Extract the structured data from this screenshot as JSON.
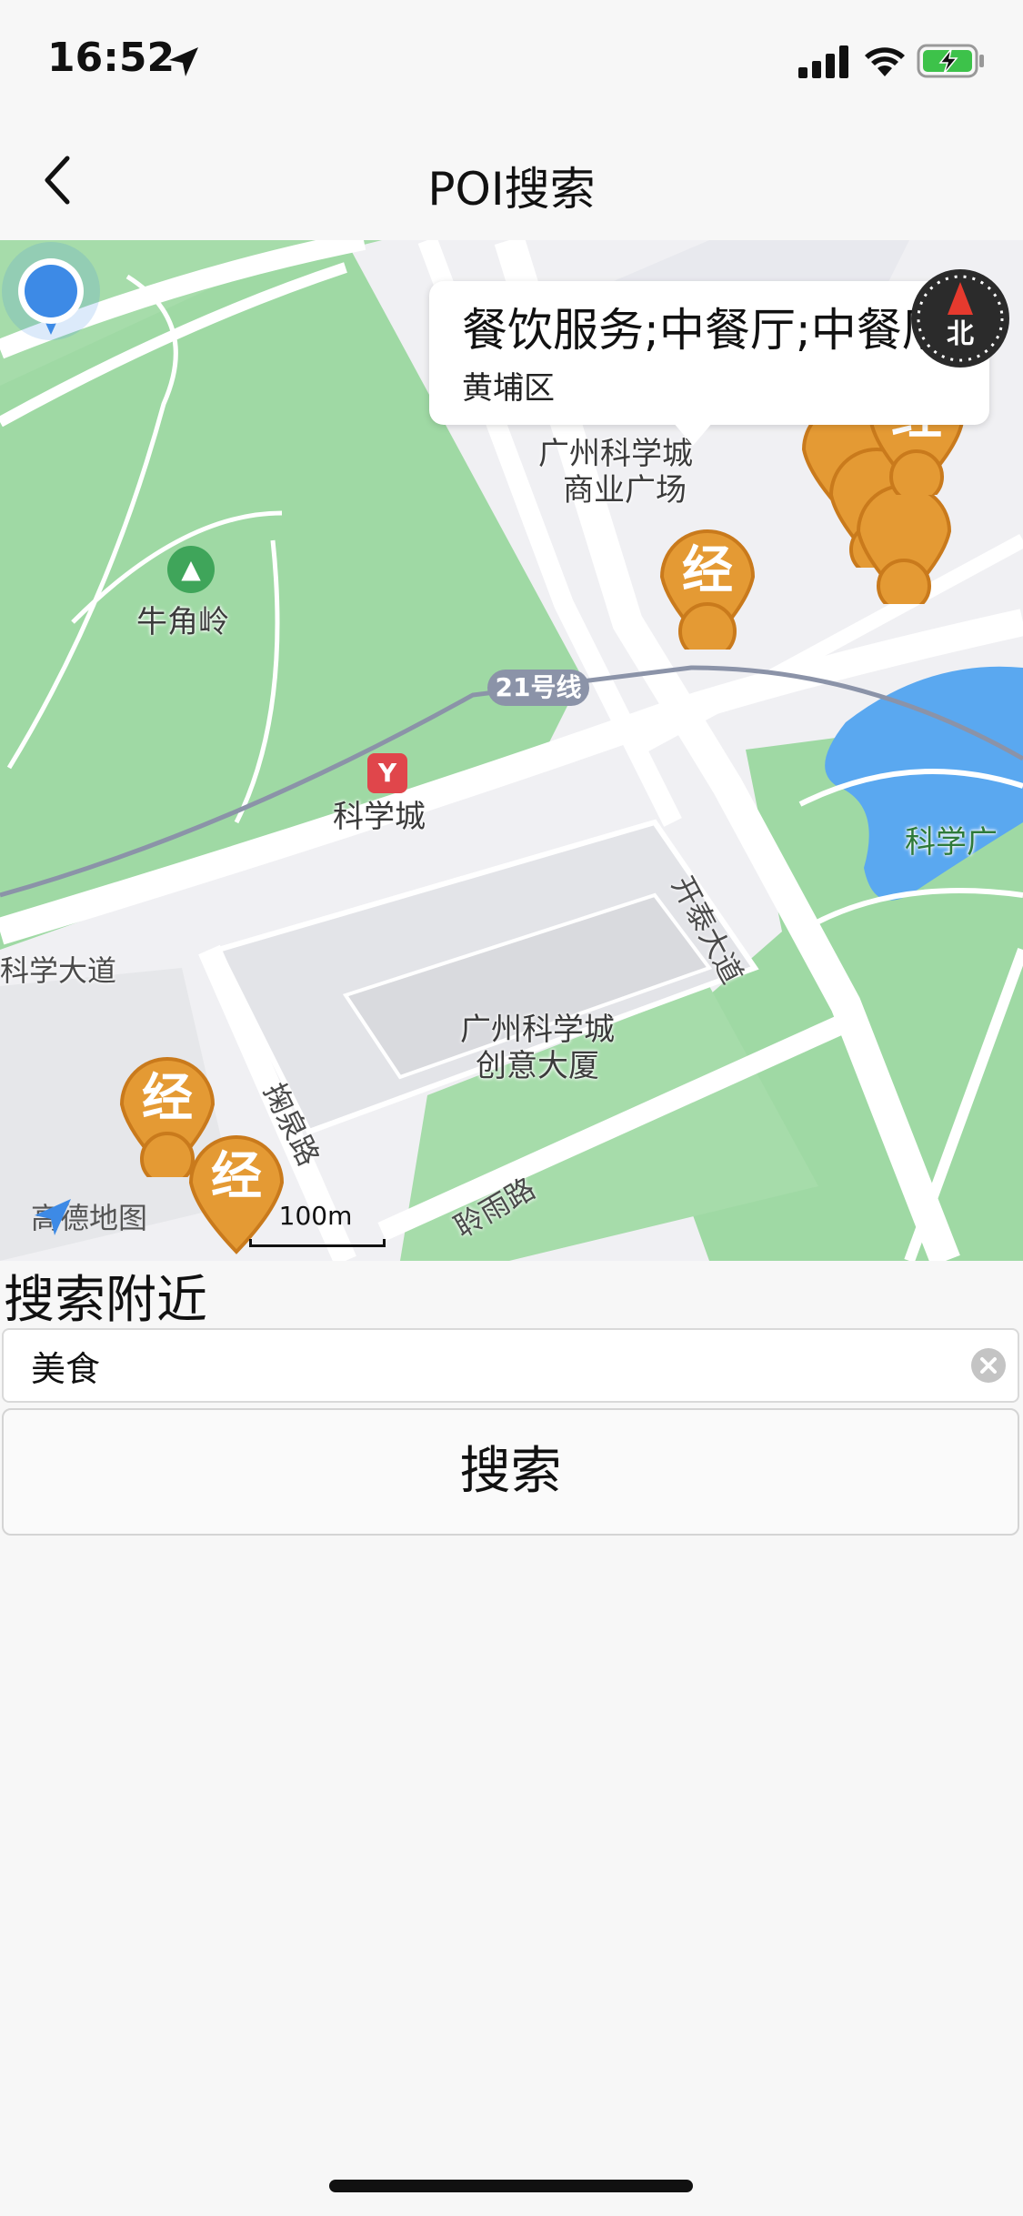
{
  "status": {
    "time": "16:52"
  },
  "nav": {
    "title": "POI搜索"
  },
  "map": {
    "info_window": {
      "title": "餐饮服务;中餐厅;中餐厅",
      "subtitle": "黄埔区"
    },
    "compass_label": "北",
    "labels": {
      "mall_line1": "广州科学城",
      "mall_line2": "商业广场",
      "hill": "牛角岭",
      "metro_station": "科学城",
      "metro_line": "21号线",
      "kexue_right": "科学广",
      "road_left": "科学大道",
      "road_kaitai": "开泰大道",
      "road_juquan": "掬泉路",
      "road_lingyu": "聆雨路",
      "building_line1": "广州科学城",
      "building_line2": "创意大厦"
    },
    "pin_label": "经",
    "logo": "高德地图",
    "scale": "100m"
  },
  "search": {
    "section_title": "搜索附近",
    "input_value": "美食",
    "button_label": "搜索"
  },
  "colors": {
    "pin": "#e49a34",
    "user_location": "#3d8ae6",
    "green_area": "#9fd9a4",
    "water": "#5aa8f0",
    "road": "#ffffff"
  }
}
